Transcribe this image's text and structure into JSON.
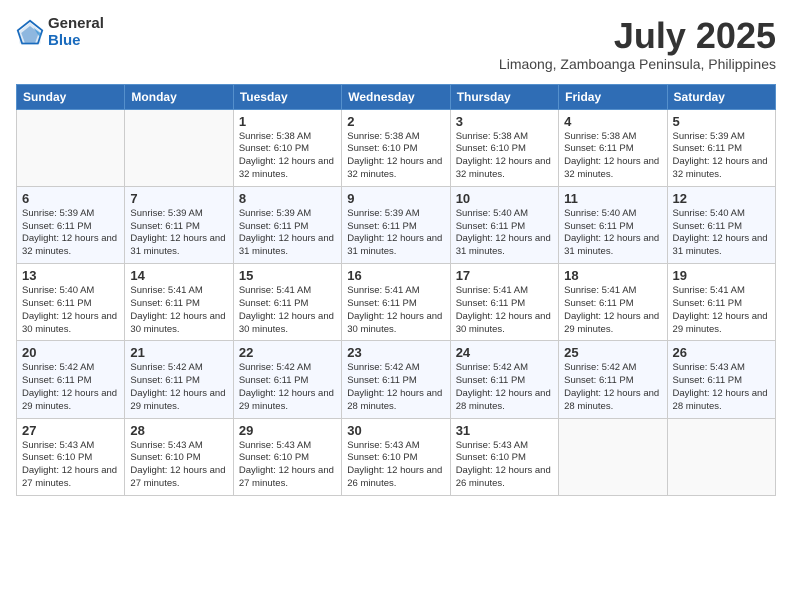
{
  "header": {
    "logo_general": "General",
    "logo_blue": "Blue",
    "month": "July 2025",
    "location": "Limaong, Zamboanga Peninsula, Philippines"
  },
  "weekdays": [
    "Sunday",
    "Monday",
    "Tuesday",
    "Wednesday",
    "Thursday",
    "Friday",
    "Saturday"
  ],
  "weeks": [
    [
      {
        "day": "",
        "detail": ""
      },
      {
        "day": "",
        "detail": ""
      },
      {
        "day": "1",
        "detail": "Sunrise: 5:38 AM\nSunset: 6:10 PM\nDaylight: 12 hours and 32 minutes."
      },
      {
        "day": "2",
        "detail": "Sunrise: 5:38 AM\nSunset: 6:10 PM\nDaylight: 12 hours and 32 minutes."
      },
      {
        "day": "3",
        "detail": "Sunrise: 5:38 AM\nSunset: 6:10 PM\nDaylight: 12 hours and 32 minutes."
      },
      {
        "day": "4",
        "detail": "Sunrise: 5:38 AM\nSunset: 6:11 PM\nDaylight: 12 hours and 32 minutes."
      },
      {
        "day": "5",
        "detail": "Sunrise: 5:39 AM\nSunset: 6:11 PM\nDaylight: 12 hours and 32 minutes."
      }
    ],
    [
      {
        "day": "6",
        "detail": "Sunrise: 5:39 AM\nSunset: 6:11 PM\nDaylight: 12 hours and 32 minutes."
      },
      {
        "day": "7",
        "detail": "Sunrise: 5:39 AM\nSunset: 6:11 PM\nDaylight: 12 hours and 31 minutes."
      },
      {
        "day": "8",
        "detail": "Sunrise: 5:39 AM\nSunset: 6:11 PM\nDaylight: 12 hours and 31 minutes."
      },
      {
        "day": "9",
        "detail": "Sunrise: 5:39 AM\nSunset: 6:11 PM\nDaylight: 12 hours and 31 minutes."
      },
      {
        "day": "10",
        "detail": "Sunrise: 5:40 AM\nSunset: 6:11 PM\nDaylight: 12 hours and 31 minutes."
      },
      {
        "day": "11",
        "detail": "Sunrise: 5:40 AM\nSunset: 6:11 PM\nDaylight: 12 hours and 31 minutes."
      },
      {
        "day": "12",
        "detail": "Sunrise: 5:40 AM\nSunset: 6:11 PM\nDaylight: 12 hours and 31 minutes."
      }
    ],
    [
      {
        "day": "13",
        "detail": "Sunrise: 5:40 AM\nSunset: 6:11 PM\nDaylight: 12 hours and 30 minutes."
      },
      {
        "day": "14",
        "detail": "Sunrise: 5:41 AM\nSunset: 6:11 PM\nDaylight: 12 hours and 30 minutes."
      },
      {
        "day": "15",
        "detail": "Sunrise: 5:41 AM\nSunset: 6:11 PM\nDaylight: 12 hours and 30 minutes."
      },
      {
        "day": "16",
        "detail": "Sunrise: 5:41 AM\nSunset: 6:11 PM\nDaylight: 12 hours and 30 minutes."
      },
      {
        "day": "17",
        "detail": "Sunrise: 5:41 AM\nSunset: 6:11 PM\nDaylight: 12 hours and 30 minutes."
      },
      {
        "day": "18",
        "detail": "Sunrise: 5:41 AM\nSunset: 6:11 PM\nDaylight: 12 hours and 29 minutes."
      },
      {
        "day": "19",
        "detail": "Sunrise: 5:41 AM\nSunset: 6:11 PM\nDaylight: 12 hours and 29 minutes."
      }
    ],
    [
      {
        "day": "20",
        "detail": "Sunrise: 5:42 AM\nSunset: 6:11 PM\nDaylight: 12 hours and 29 minutes."
      },
      {
        "day": "21",
        "detail": "Sunrise: 5:42 AM\nSunset: 6:11 PM\nDaylight: 12 hours and 29 minutes."
      },
      {
        "day": "22",
        "detail": "Sunrise: 5:42 AM\nSunset: 6:11 PM\nDaylight: 12 hours and 29 minutes."
      },
      {
        "day": "23",
        "detail": "Sunrise: 5:42 AM\nSunset: 6:11 PM\nDaylight: 12 hours and 28 minutes."
      },
      {
        "day": "24",
        "detail": "Sunrise: 5:42 AM\nSunset: 6:11 PM\nDaylight: 12 hours and 28 minutes."
      },
      {
        "day": "25",
        "detail": "Sunrise: 5:42 AM\nSunset: 6:11 PM\nDaylight: 12 hours and 28 minutes."
      },
      {
        "day": "26",
        "detail": "Sunrise: 5:43 AM\nSunset: 6:11 PM\nDaylight: 12 hours and 28 minutes."
      }
    ],
    [
      {
        "day": "27",
        "detail": "Sunrise: 5:43 AM\nSunset: 6:10 PM\nDaylight: 12 hours and 27 minutes."
      },
      {
        "day": "28",
        "detail": "Sunrise: 5:43 AM\nSunset: 6:10 PM\nDaylight: 12 hours and 27 minutes."
      },
      {
        "day": "29",
        "detail": "Sunrise: 5:43 AM\nSunset: 6:10 PM\nDaylight: 12 hours and 27 minutes."
      },
      {
        "day": "30",
        "detail": "Sunrise: 5:43 AM\nSunset: 6:10 PM\nDaylight: 12 hours and 26 minutes."
      },
      {
        "day": "31",
        "detail": "Sunrise: 5:43 AM\nSunset: 6:10 PM\nDaylight: 12 hours and 26 minutes."
      },
      {
        "day": "",
        "detail": ""
      },
      {
        "day": "",
        "detail": ""
      }
    ]
  ]
}
